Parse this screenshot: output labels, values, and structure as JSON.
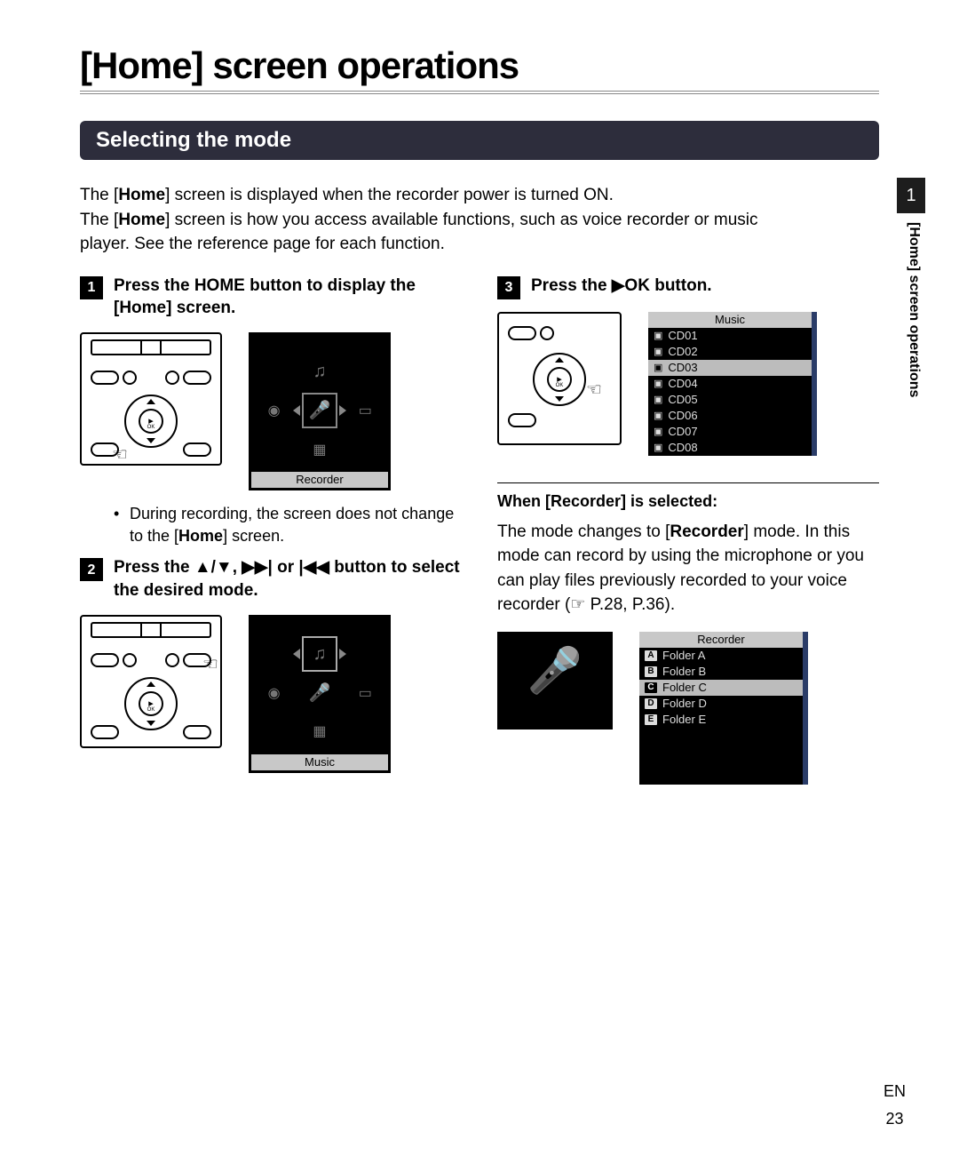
{
  "page_title": "[Home] screen operations",
  "section_title": "Selecting the mode",
  "intro": {
    "line1_pre": "The [",
    "line1_b": "Home",
    "line1_post": "] screen is displayed when the recorder power is turned ON.",
    "line2_pre": "The [",
    "line2_b": "Home",
    "line2_post": "] screen is how you access available functions, such as voice recorder or music player. See the reference page for each function."
  },
  "side": {
    "chapter": "1",
    "label": "[Home] screen operations"
  },
  "footer": {
    "lang": "EN",
    "page": "23"
  },
  "steps": {
    "s1": {
      "num": "1",
      "text_pre": "Press the ",
      "text_b1": "HOME",
      "text_mid": " button to display the [",
      "text_b2": "Home",
      "text_post": "] screen."
    },
    "s1_bullet": {
      "pre": "During recording, the screen does not change to the [",
      "b": "Home",
      "post": "] screen."
    },
    "s2": {
      "num": "2",
      "text": "Press the ▲/▼, ▶▶| or |◀◀ button to select the desired mode."
    },
    "s3": {
      "num": "3",
      "text": "Press the ▶OK button."
    }
  },
  "lcd": {
    "recorder_caption": "Recorder",
    "music_caption": "Music"
  },
  "music_list": {
    "title": "Music",
    "items": [
      "CD01",
      "CD02",
      "CD03",
      "CD04",
      "CD05",
      "CD06",
      "CD07",
      "CD08"
    ],
    "selected_index": 2
  },
  "when_recorder": {
    "heading": "When [Recorder] is selected:",
    "para_pre": "The mode changes to [",
    "para_b": "Recorder",
    "para_post": "] mode. In this mode can record by using the microphone or you can play files previously recorded to your voice recorder (☞ P.28, P.36)."
  },
  "folder_list": {
    "title": "Recorder",
    "items": [
      {
        "badge": "A",
        "label": "Folder A"
      },
      {
        "badge": "B",
        "label": "Folder B"
      },
      {
        "badge": "C",
        "label": "Folder C"
      },
      {
        "badge": "D",
        "label": "Folder D"
      },
      {
        "badge": "E",
        "label": "Folder E"
      }
    ],
    "selected_index": 2
  }
}
